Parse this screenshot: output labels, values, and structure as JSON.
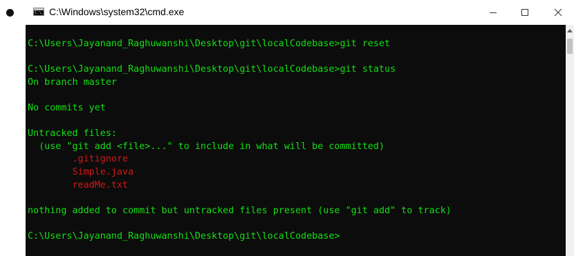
{
  "window": {
    "title": "C:\\Windows\\system32\\cmd.exe",
    "icon_label": "C:\\.",
    "controls": [
      "minimize-icon",
      "maximize-icon",
      "close-icon"
    ]
  },
  "colors": {
    "console_background": "#0c0c0c",
    "text_green": "#13e013",
    "text_red": "#d01818"
  },
  "console": {
    "lines": [
      {
        "text": "C:\\Users\\Jayanand_Raghuwanshi\\Desktop\\git\\localCodebase>git reset",
        "color": "green"
      },
      {
        "text": "",
        "color": "green"
      },
      {
        "text": "C:\\Users\\Jayanand_Raghuwanshi\\Desktop\\git\\localCodebase>git status",
        "color": "green"
      },
      {
        "text": "On branch master",
        "color": "green"
      },
      {
        "text": "",
        "color": "green"
      },
      {
        "text": "No commits yet",
        "color": "green"
      },
      {
        "text": "",
        "color": "green"
      },
      {
        "text": "Untracked files:",
        "color": "green"
      },
      {
        "text": "  (use \"git add <file>...\" to include in what will be committed)",
        "color": "green"
      },
      {
        "text": "        .gitignore",
        "color": "red"
      },
      {
        "text": "        Simple.java",
        "color": "red"
      },
      {
        "text": "        readMe.txt",
        "color": "red"
      },
      {
        "text": "",
        "color": "green"
      },
      {
        "text": "nothing added to commit but untracked files present (use \"git add\" to track)",
        "color": "green"
      },
      {
        "text": "",
        "color": "green"
      },
      {
        "text": "C:\\Users\\Jayanand_Raghuwanshi\\Desktop\\git\\localCodebase>",
        "color": "green"
      }
    ]
  }
}
